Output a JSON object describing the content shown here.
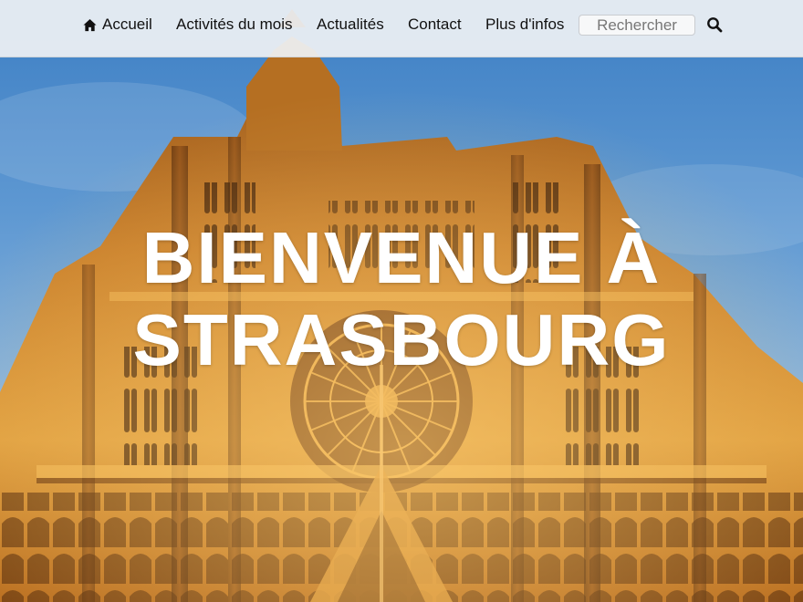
{
  "navbar": {
    "items": [
      {
        "label": "Accueil",
        "icon": "home-icon"
      },
      {
        "label": "Activités du mois"
      },
      {
        "label": "Actualités"
      },
      {
        "label": "Contact"
      },
      {
        "label": "Plus d'infos"
      }
    ],
    "search": {
      "placeholder": "Rechercher",
      "button_icon": "search-icon"
    },
    "background": "#eef1f4"
  },
  "hero": {
    "title_line1": "BIENVENUE À",
    "title_line2": "STRASBOURG",
    "image": "Strasbourg cathedral facade at sunset",
    "colors": {
      "sky": "#5e98d2",
      "stone": "#d58a2c",
      "title": "#ffffff"
    }
  }
}
